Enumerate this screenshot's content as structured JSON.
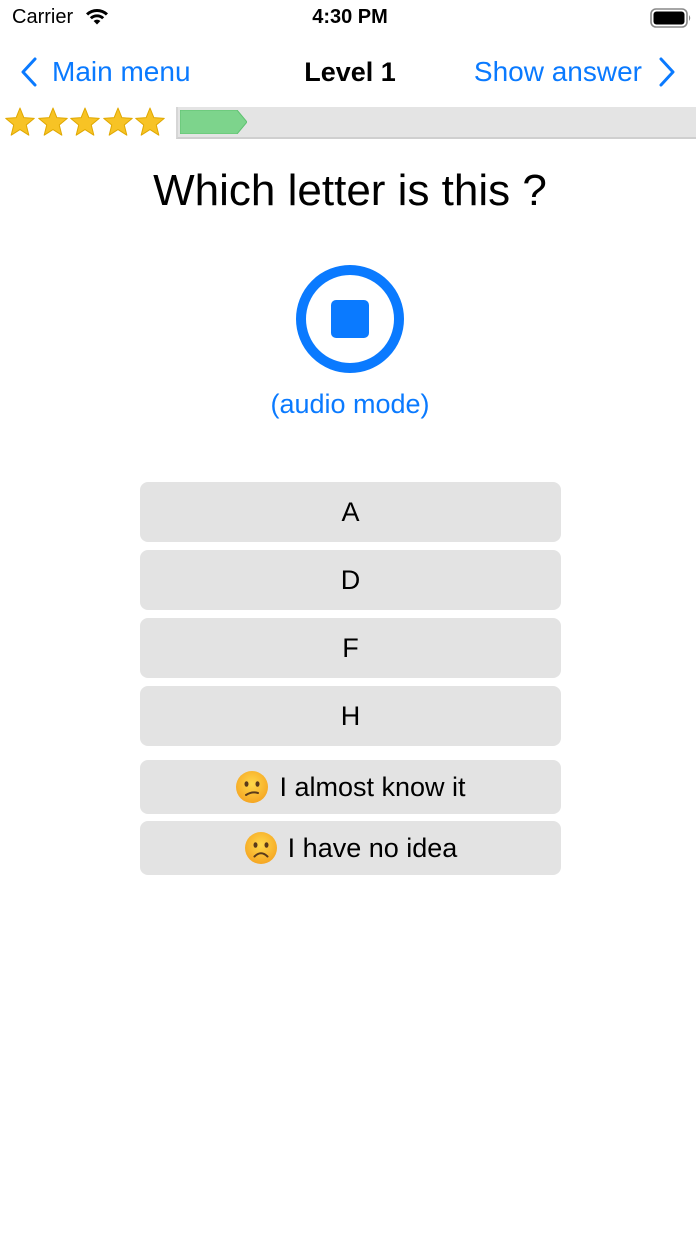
{
  "status_bar": {
    "carrier": "Carrier",
    "time": "4:30 PM",
    "wifi_icon": "wifi-icon",
    "battery_icon": "battery-icon"
  },
  "nav": {
    "back_label": "Main menu",
    "title": "Level 1",
    "forward_label": "Show answer",
    "accent_color": "#0a7aff"
  },
  "rating": {
    "stars_filled": 5,
    "stars_total": 5,
    "star_color": "#f7c325"
  },
  "progress": {
    "fraction": 0.13,
    "fill_color": "#7dd48c"
  },
  "question": {
    "text": "Which letter is this ?"
  },
  "audio": {
    "icon": "stop-icon",
    "mode_label": "(audio mode)"
  },
  "answers": [
    {
      "label": "A"
    },
    {
      "label": "D"
    },
    {
      "label": "F"
    },
    {
      "label": "H"
    }
  ],
  "feedback": [
    {
      "label": "I almost know it",
      "icon": "confused-face-icon"
    },
    {
      "label": "I have no idea",
      "icon": "frowning-face-icon"
    }
  ]
}
